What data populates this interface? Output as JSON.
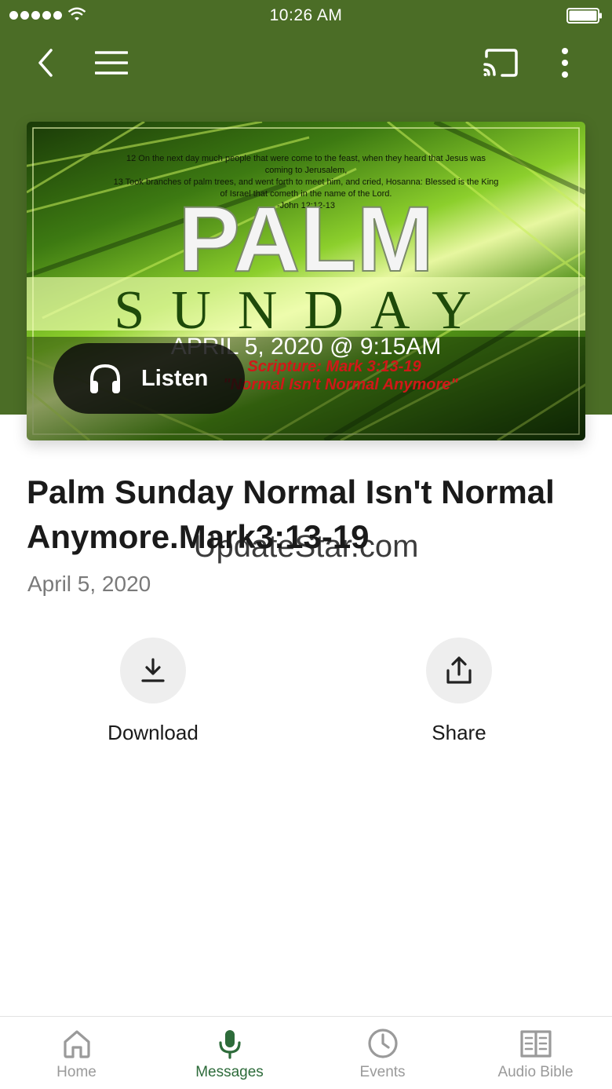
{
  "status_bar": {
    "time": "10:26 AM"
  },
  "hero": {
    "verse_lines": [
      "12 On the next day much people that were come to the feast, when they heard that Jesus was",
      "coming to Jerusalem,",
      "13 Took branches of palm trees, and went forth to meet him, and cried, Hosanna: Blessed is the King",
      "of Israel that cometh in the name of the Lord.",
      "-John 12:12-13"
    ],
    "big_word_1": "PALM",
    "big_word_2": "SUNDAY",
    "date_line": "APRIL 5, 2020 @ 9:15AM",
    "scripture_line": "Scripture: Mark 3:13-19",
    "sermon_line": "\"Normal Isn't Normal Anymore\"",
    "listen_label": "Listen"
  },
  "message": {
    "title": "Palm Sunday Normal Isn't Normal Anymore.Mark3:13-19",
    "date": "April 5, 2020"
  },
  "watermark": "UpdateStar.com",
  "actions": {
    "download_label": "Download",
    "share_label": "Share"
  },
  "tabs": [
    {
      "label": "Home",
      "icon": "home-icon"
    },
    {
      "label": "Messages",
      "icon": "microphone-icon"
    },
    {
      "label": "Events",
      "icon": "clock-icon"
    },
    {
      "label": "Audio Bible",
      "icon": "book-icon"
    }
  ],
  "colors": {
    "header_green": "#4b6d26",
    "active_tab": "#2d6b3a",
    "inactive_tab": "#9a9a9a"
  }
}
